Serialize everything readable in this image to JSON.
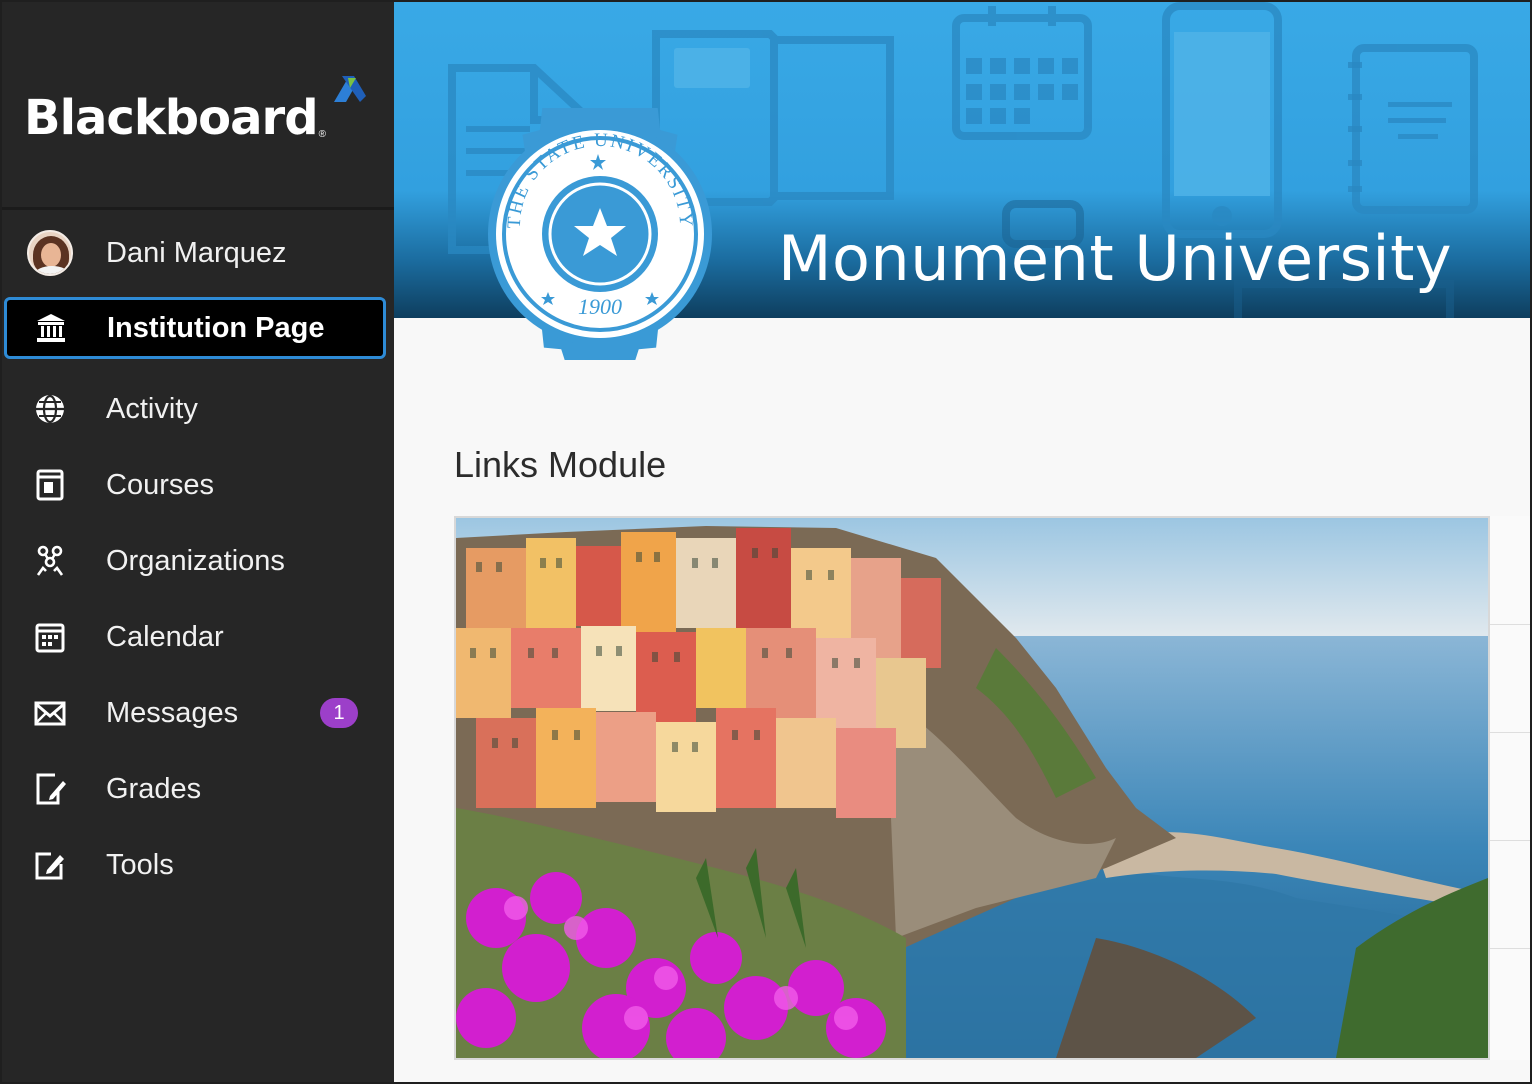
{
  "brand": {
    "logo_text": "Blackboard",
    "logo_reg": "®"
  },
  "user": {
    "name": "Dani Marquez"
  },
  "nav": {
    "items": [
      {
        "label": "Institution Page",
        "icon": "institution-icon",
        "active": true
      },
      {
        "label": "Activity",
        "icon": "globe-icon"
      },
      {
        "label": "Courses",
        "icon": "courses-icon"
      },
      {
        "label": "Organizations",
        "icon": "organizations-icon"
      },
      {
        "label": "Calendar",
        "icon": "calendar-icon"
      },
      {
        "label": "Messages",
        "icon": "envelope-icon",
        "badge": "1"
      },
      {
        "label": "Grades",
        "icon": "grades-icon"
      },
      {
        "label": "Tools",
        "icon": "tools-icon"
      }
    ]
  },
  "banner": {
    "title": "Monument University",
    "seal": {
      "top_text": "THE STATE UNIVERSITY",
      "year": "1900"
    }
  },
  "module": {
    "title": "Links Module"
  },
  "colors": {
    "sidebar": "#262626",
    "active_border": "#2e8bd6",
    "badge": "#9c3fc9",
    "banner": "#39a9e6"
  }
}
